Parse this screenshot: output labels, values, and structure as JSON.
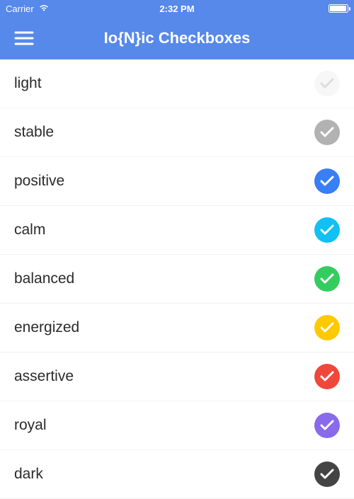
{
  "statusBar": {
    "carrier": "Carrier",
    "time": "2:32 PM"
  },
  "nav": {
    "title": "Io{N}ic Checkboxes"
  },
  "items": [
    {
      "label": "light",
      "color": "#f7f7f7",
      "check": "#dddddd"
    },
    {
      "label": "stable",
      "color": "#b2b2b2",
      "check": "#ffffff"
    },
    {
      "label": "positive",
      "color": "#387ef5",
      "check": "#ffffff"
    },
    {
      "label": "calm",
      "color": "#11c1f3",
      "check": "#ffffff"
    },
    {
      "label": "balanced",
      "color": "#33cd5f",
      "check": "#ffffff"
    },
    {
      "label": "energized",
      "color": "#ffc900",
      "check": "#ffffff"
    },
    {
      "label": "assertive",
      "color": "#ef473a",
      "check": "#ffffff"
    },
    {
      "label": "royal",
      "color": "#886aea",
      "check": "#ffffff"
    },
    {
      "label": "dark",
      "color": "#444444",
      "check": "#ffffff"
    }
  ]
}
